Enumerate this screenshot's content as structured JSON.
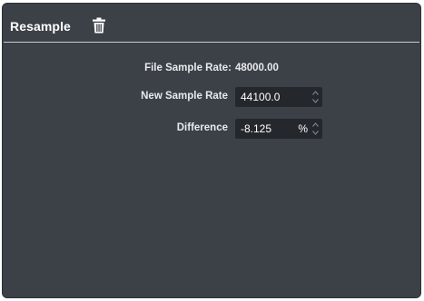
{
  "panel": {
    "title": "Resample",
    "delete_icon": "trash-icon"
  },
  "file_sample_rate": {
    "label": "File Sample Rate:",
    "value": "48000.00"
  },
  "new_sample_rate": {
    "label": "New Sample Rate",
    "value": "44100.0",
    "spinner_icon": "up-down-spinner-icon"
  },
  "difference": {
    "label": "Difference",
    "value": "-8.125",
    "unit": "%",
    "spinner_icon": "up-down-spinner-icon"
  },
  "colors": {
    "panel_background": "#3c4148",
    "field_background": "#24282d",
    "text": "#ffffff"
  }
}
